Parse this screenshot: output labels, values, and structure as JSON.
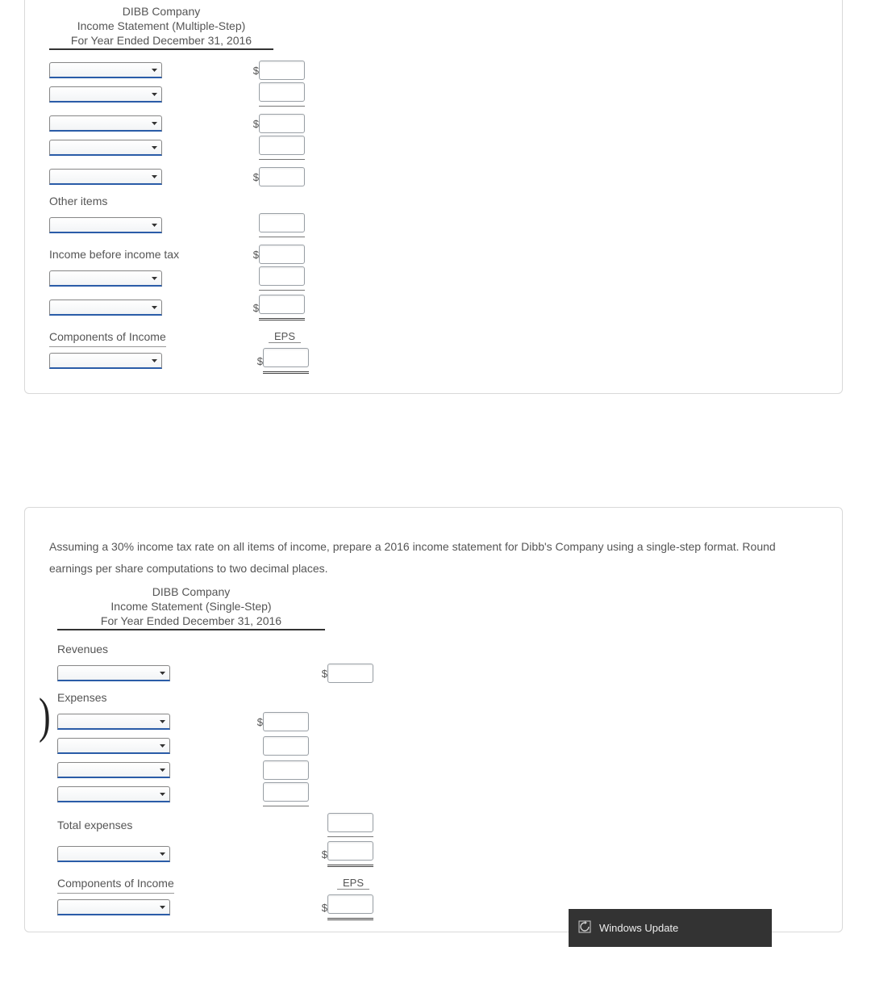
{
  "multi": {
    "company": "DIBB Company",
    "title": "Income Statement (Multiple-Step)",
    "period": "For Year Ended December 31, 2016",
    "other_items": "Other items",
    "ibt": "Income before income tax",
    "components": "Components of Income",
    "eps": "EPS"
  },
  "single": {
    "instructions": "Assuming a 30% income tax rate on all items of income, prepare a 2016 income statement for Dibb's Company using a single-step format. Round earnings per share computations to two decimal places.",
    "company": "DIBB Company",
    "title": "Income Statement (Single-Step)",
    "period": "For Year Ended December 31, 2016",
    "revenues": "Revenues",
    "expenses": "Expenses",
    "total_expenses": "Total expenses",
    "components": "Components of Income",
    "eps": "EPS"
  },
  "toast": {
    "text": "Windows Update"
  },
  "sym": {
    "dollar": "$"
  }
}
